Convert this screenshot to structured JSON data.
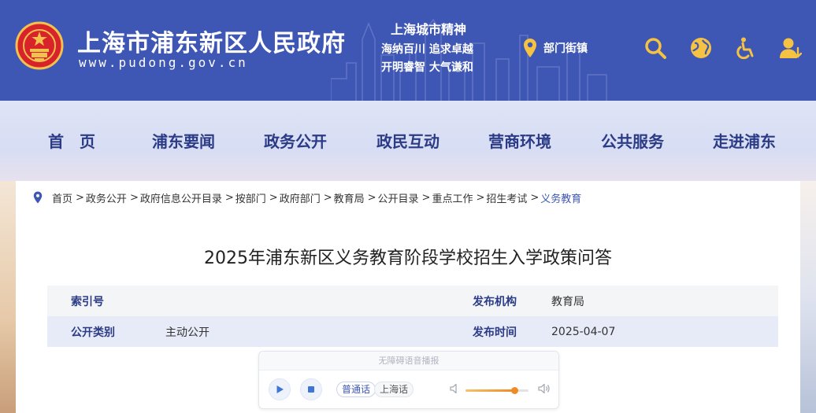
{
  "header": {
    "title": "上海市浦东新区人民政府",
    "url": "www.pudong.gov.cn",
    "spirit_title": "上海城市精神",
    "spirit_line1": "海纳百川  追求卓越",
    "spirit_line2": "开明睿智  大气谦和",
    "locator_label": "部门街镇",
    "icons": [
      "search-icon",
      "globe-icon",
      "accessibility-icon",
      "user-icon"
    ],
    "icon_color": "#f5c242",
    "background": "#3e56b4"
  },
  "nav": {
    "items": [
      "首　页",
      "浦东要闻",
      "政务公开",
      "政民互动",
      "营商环境",
      "公共服务",
      "走进浦东"
    ]
  },
  "breadcrumb": {
    "items": [
      "首页",
      "政务公开",
      "政府信息公开目录",
      "按部门",
      "政府部门",
      "教育局",
      "公开目录",
      "重点工作",
      "招生考试",
      "义务教育"
    ],
    "separator": ">"
  },
  "article": {
    "title": "2025年浦东新区义务教育阶段学校招生入学政策问答"
  },
  "meta": {
    "index_label": "索引号",
    "index_value": "",
    "org_label": "发布机构",
    "org_value": "教育局",
    "category_label": "公开类别",
    "category_value": "主动公开",
    "date_label": "发布时间",
    "date_value": "2025-04-07"
  },
  "player": {
    "header": "无障碍语音播报",
    "lang_active": "普通话",
    "lang_other": "上海话",
    "volume": 0.78,
    "accent": "#f08a24"
  }
}
